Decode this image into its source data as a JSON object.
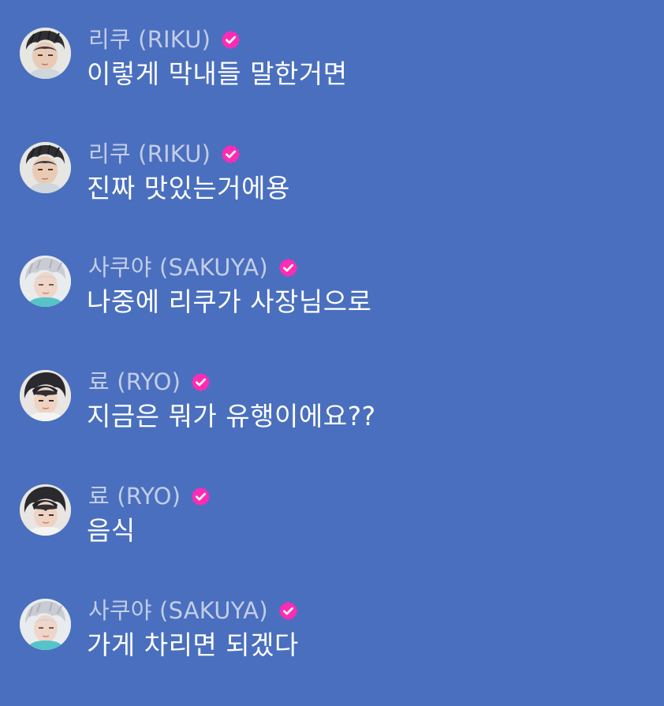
{
  "colors": {
    "background": "#4a6fbe",
    "sender_name": "#c3cde8",
    "message_text": "#ffffff",
    "verified_badge": "#ff2bb5"
  },
  "messages": [
    {
      "sender": "리쿠 (RIKU)",
      "text": "이렇게 막내들 말한거면",
      "avatar_icon": "riku-avatar",
      "badge_icon": "verified-check-icon"
    },
    {
      "sender": "리쿠 (RIKU)",
      "text": "진짜 맛있는거에용",
      "avatar_icon": "riku-avatar",
      "badge_icon": "verified-check-icon"
    },
    {
      "sender": "사쿠야 (SAKUYA)",
      "text": "나중에 리쿠가 사장님으로",
      "avatar_icon": "sakuya-avatar",
      "badge_icon": "verified-check-icon"
    },
    {
      "sender": "료 (RYO)",
      "text": "지금은 뭐가 유행이에요??",
      "avatar_icon": "ryo-avatar",
      "badge_icon": "verified-check-icon"
    },
    {
      "sender": "료 (RYO)",
      "text": "음식",
      "avatar_icon": "ryo-avatar",
      "badge_icon": "verified-check-icon"
    },
    {
      "sender": "사쿠야 (SAKUYA)",
      "text": "가게 차리면 되겠다",
      "avatar_icon": "sakuya-avatar",
      "badge_icon": "verified-check-icon"
    }
  ]
}
